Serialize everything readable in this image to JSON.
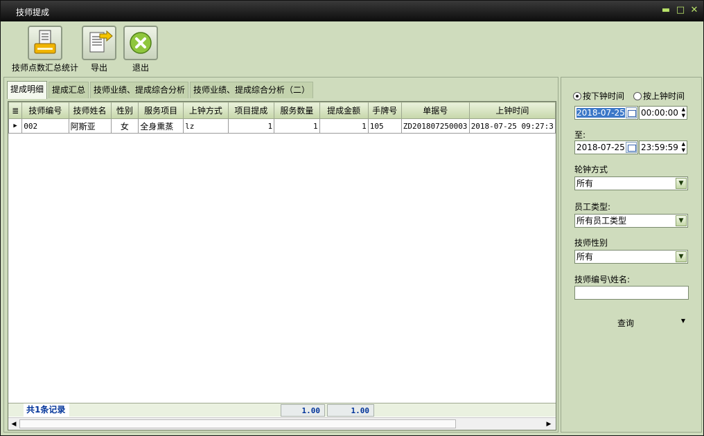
{
  "window": {
    "title": "技师提成"
  },
  "colors": {
    "panel": "#cfdcbd",
    "accent": "#003399",
    "titlebar": "#0d0d0d",
    "winbtn": "#b9e36a"
  },
  "toolbar": {
    "items": [
      {
        "label": "技师点数汇总统计",
        "icon": "printer-icon"
      },
      {
        "label": "导出",
        "icon": "export-icon"
      },
      {
        "label": "退出",
        "icon": "exit-icon"
      }
    ]
  },
  "tabs": [
    "提成明细",
    "提成汇总",
    "技师业绩、提成综合分析",
    "技师业绩、提成综合分析（二）"
  ],
  "grid": {
    "columns": [
      "技师编号",
      "技师姓名",
      "性别",
      "服务项目",
      "上钟方式",
      "项目提成",
      "服务数量",
      "提成金额",
      "手牌号",
      "单据号",
      "上钟时间"
    ],
    "rows": [
      [
        "002",
        "阿斯亚",
        "女",
        "全身熏蒸",
        "lz",
        "1",
        "1",
        "1",
        "105",
        "ZD201807250003",
        "2018-07-25 09:27:3"
      ]
    ],
    "footer": {
      "count": "共1条记录",
      "sum_qty": "1.00",
      "sum_amount": "1.00"
    }
  },
  "filters": {
    "radio_end": "按下钟时间",
    "radio_start": "按上钟时间",
    "date_from": "2018-07-25",
    "time_from": "00:00:00",
    "to_label": "至:",
    "date_to": "2018-07-25",
    "time_to": "23:59:59",
    "shift_label": "轮钟方式",
    "shift_value": "所有",
    "emp_type_label": "员工类型:",
    "emp_type_value": "所有员工类型",
    "gender_label": "技师性别",
    "gender_value": "所有",
    "id_label": "技师编号\\姓名:",
    "id_value": "",
    "query_label": "查询"
  }
}
